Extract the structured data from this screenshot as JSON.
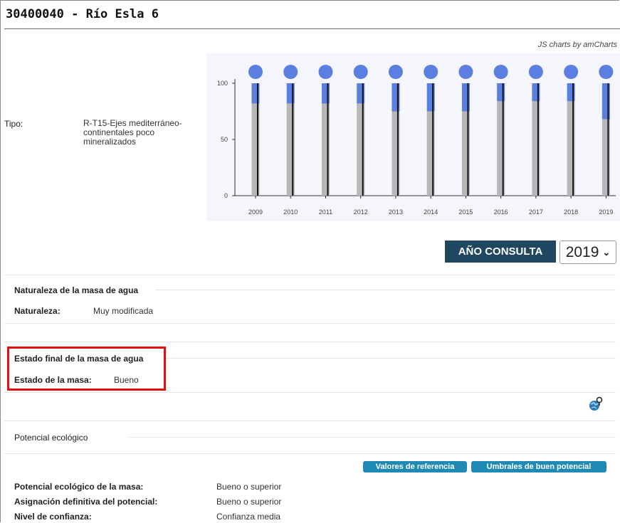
{
  "page": {
    "title": "30400040 - Río Esla 6",
    "chart_credit": "JS charts by amCharts"
  },
  "tipo": {
    "label": "Tipo:",
    "value": "R-T15-Ejes mediterráneo-continentales poco mineralizados"
  },
  "chart_data": {
    "type": "bar",
    "categories": [
      "2009",
      "2010",
      "2011",
      "2012",
      "2013",
      "2014",
      "2015",
      "2016",
      "2017",
      "2018",
      "2019"
    ],
    "series": [
      {
        "values": [
          82,
          82,
          82,
          82,
          75,
          75,
          75,
          84,
          84,
          84,
          68
        ],
        "color": "#b7b7b7"
      },
      {
        "values": [
          18,
          18,
          18,
          18,
          25,
          25,
          25,
          16,
          16,
          16,
          32
        ],
        "color": "#5b7fe0"
      }
    ],
    "marker_value": [
      100,
      100,
      100,
      100,
      100,
      100,
      100,
      100,
      100,
      100,
      100
    ],
    "ylim": [
      0,
      100
    ],
    "yticks": [
      "0",
      "50",
      "100"
    ],
    "stacked": true,
    "marker_color": "#5b7fe0"
  },
  "consulta": {
    "button_label": "AÑO CONSULTA",
    "selected_year": "2019"
  },
  "naturaleza": {
    "section_title": "Naturaleza de la masa de agua",
    "label": "Naturaleza:",
    "value": "Muy modificada"
  },
  "estado_final": {
    "section_title": "Estado final de la masa de agua",
    "label": "Estado de la masa:",
    "value": "Bueno"
  },
  "potencial": {
    "section_title": "Potencial ecológico",
    "btn_referencia": "Valores de referencia",
    "btn_umbrales": "Umbrales de buen potencial",
    "rows": [
      {
        "label": "Potencial ecológico de la masa:",
        "value": "Bueno o superior"
      },
      {
        "label": "Asignación definitiva del potencial:",
        "value": "Bueno o superior"
      },
      {
        "label": "Nivel de confianza:",
        "value": "Confianza media"
      }
    ]
  },
  "colors": {
    "header_button": "#1f4760",
    "action_button": "#1f8bb5",
    "highlight_border": "#e01010"
  }
}
